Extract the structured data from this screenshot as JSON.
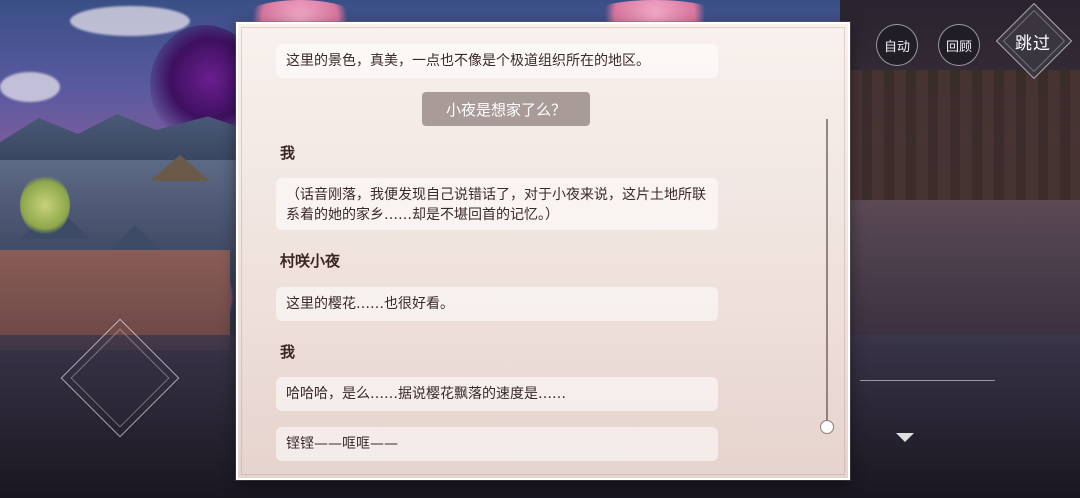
{
  "controls": {
    "auto_label": "自动",
    "review_label": "回顾",
    "skip_label": "跳过"
  },
  "backlog": {
    "entries": [
      {
        "speaker": "",
        "text": "这里的景色，真美，一点也不像是个极道组织所在的地区。"
      },
      {
        "choice": "小夜是想家了么？"
      },
      {
        "speaker": "我",
        "text": "（话音刚落，我便发现自己说错话了，对于小夜来说，这片土地所联系着的她的家乡……却是不堪回首的记忆。）"
      },
      {
        "speaker": "村咲小夜",
        "text": "这里的樱花……也很好看。"
      },
      {
        "speaker": "我",
        "text": "哈哈哈，是么……据说樱花飘落的速度是……"
      },
      {
        "speaker": "",
        "text": "铿铿——哐哐——"
      }
    ],
    "scroll_position": 1.0
  },
  "icons": {
    "advance": "triangle-down-icon",
    "decoration": "diamond-frame-icon"
  },
  "colors": {
    "panel_bg": "#f3e8e3",
    "choice_bg": "#a89b98",
    "text": "#3b2a2a"
  }
}
